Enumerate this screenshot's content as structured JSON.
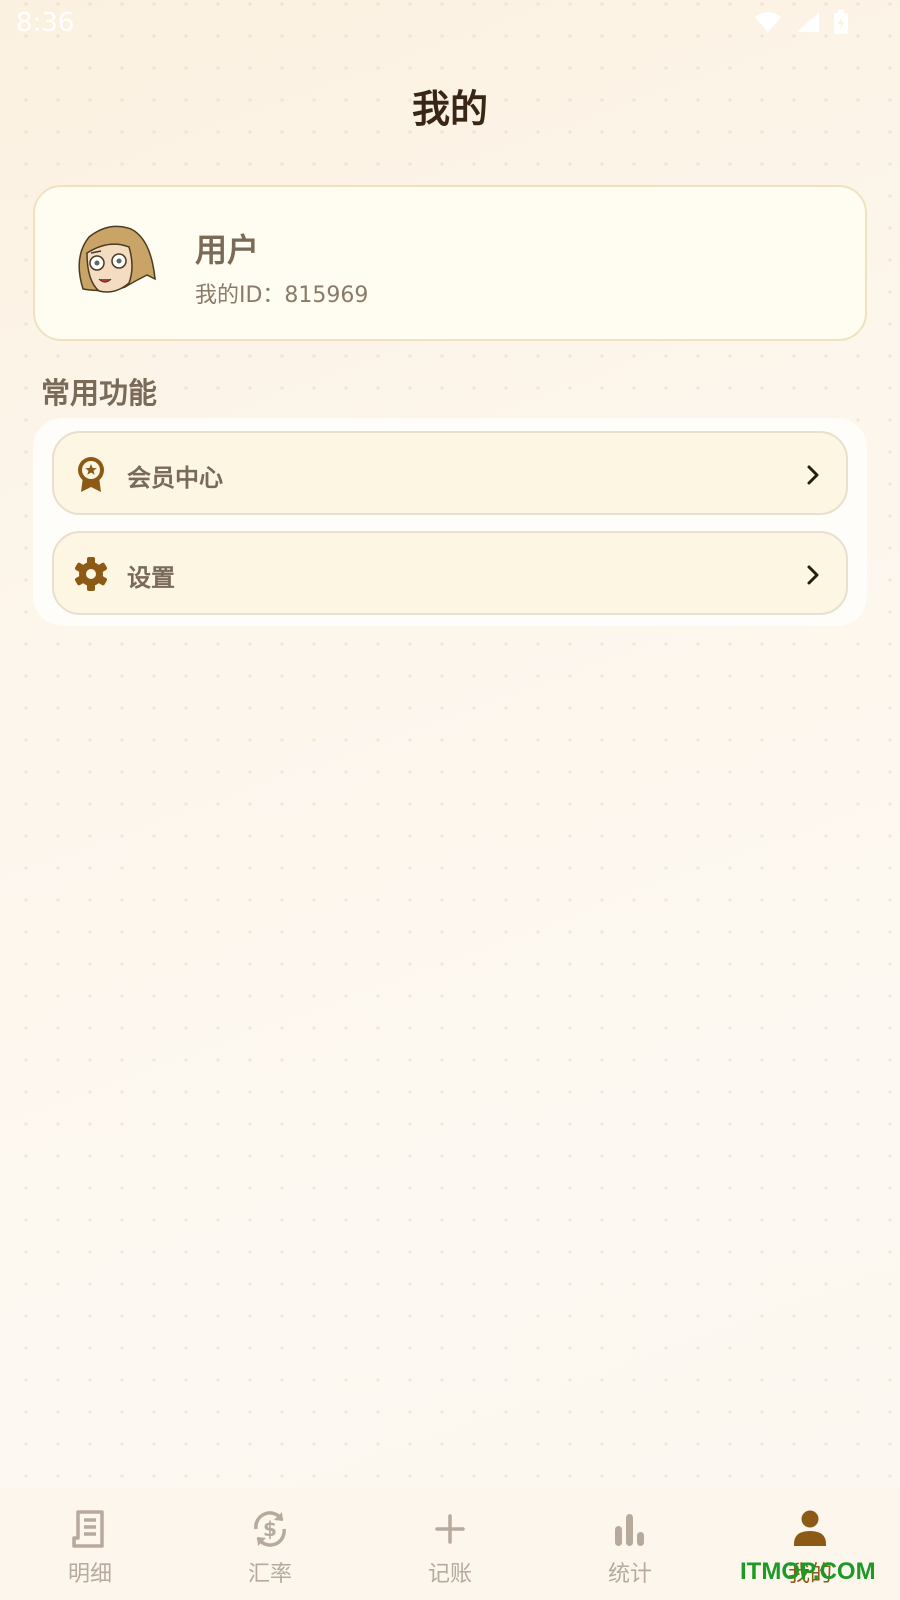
{
  "status_bar": {
    "time": "8:36"
  },
  "header": {
    "title": "我的"
  },
  "profile": {
    "name": "用户",
    "id_label": "我的ID：815969"
  },
  "section": {
    "title": "常用功能"
  },
  "menu": {
    "items": [
      {
        "label": "会员中心",
        "icon": "medal-icon"
      },
      {
        "label": "设置",
        "icon": "gear-icon"
      }
    ]
  },
  "tabs": [
    {
      "label": "明细",
      "icon": "receipt-icon"
    },
    {
      "label": "汇率",
      "icon": "currency-exchange-icon"
    },
    {
      "label": "记账",
      "icon": "plus-icon"
    },
    {
      "label": "统计",
      "icon": "bar-chart-icon"
    },
    {
      "label": "我的",
      "icon": "person-icon",
      "active": true
    }
  ],
  "watermark": "ITMOP.COM",
  "colors": {
    "accent": "#8c5a14",
    "inactive": "#b7aa9c",
    "card_border": "#f0e1bf"
  }
}
